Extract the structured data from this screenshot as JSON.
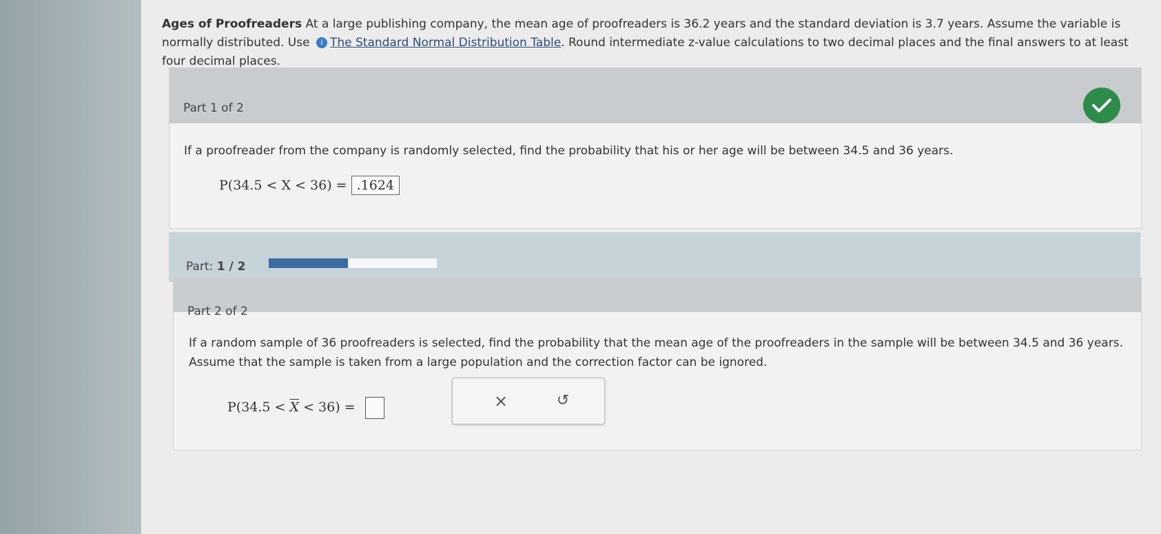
{
  "intro": {
    "title": "Ages of Proofreaders",
    "text1": " At a large publishing company, the mean age of proofreaders is 36.2 years and the standard deviation is 3.7 years. Assume the variable is normally distributed. Use",
    "link": "The Standard Normal Distribution Table",
    "text2": ". Round intermediate z-value calculations to two decimal places and the final answers to at least four decimal places."
  },
  "part1": {
    "header": "Part 1 of 2",
    "question": "If a proofreader from the company is randomly selected, find the probability that his or her age will be between 34.5 and 36 years.",
    "expr": "P(34.5 < X < 36) =",
    "answer": ".1624",
    "status_icon": "checkmark-icon"
  },
  "progress": {
    "label": "Part:",
    "value": "1 / 2",
    "fraction": 0.47
  },
  "part2": {
    "header": "Part 2 of 2",
    "question": "If a random sample of 36 proofreaders is selected, find the probability that the mean age of the proofreaders in the sample will be between 34.5 and 36 years. Assume that the sample is taken from a large population and the correction factor can be ignored.",
    "expr_prefix": "P(34.5 < ",
    "expr_var": "X",
    "expr_suffix": " < 36) =",
    "answer": ""
  },
  "tools": {
    "clear_icon": "×",
    "undo_icon": "↺"
  },
  "colors": {
    "accent": "#3a6aa0",
    "success": "#2e8b4a"
  }
}
